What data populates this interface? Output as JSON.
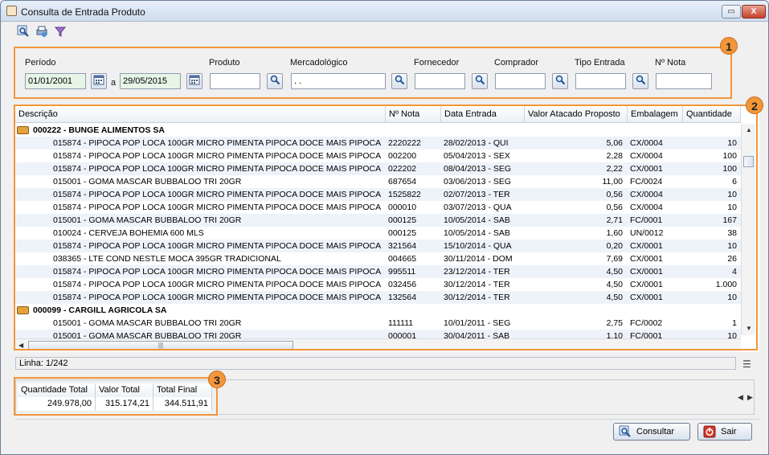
{
  "window": {
    "title": "Consulta de Entrada Produto",
    "restore_glyph": "▭",
    "close_glyph": "X"
  },
  "toolbar": {
    "icons": [
      "search-icon",
      "print-icon",
      "filter-icon"
    ]
  },
  "filters": {
    "periodo_label": "Período",
    "periodo_from": "01/01/2001",
    "periodo_sep": "a",
    "periodo_to": "29/05/2015",
    "produto_label": "Produto",
    "produto_value": "",
    "mercadologico_label": "Mercadológico",
    "mercadologico_value": " .  .",
    "fornecedor_label": "Fornecedor",
    "fornecedor_value": "",
    "comprador_label": "Comprador",
    "comprador_value": "",
    "tipo_entrada_label": "Tipo Entrada",
    "tipo_entrada_value": "",
    "nota_label": "Nº Nota",
    "nota_value": ""
  },
  "annotations": {
    "badge1": "1",
    "badge2": "2",
    "badge3": "3"
  },
  "grid": {
    "columns": [
      "Descrição",
      "Nº Nota",
      "Data Entrada",
      "Valor Atacado Proposto",
      "Embalagem",
      "Quantidade"
    ],
    "rows": [
      {
        "group": true,
        "text": "000222 - BUNGE ALIMENTOS SA"
      },
      {
        "desc": "015874 - PIPOCA POP LOCA 100GR MICRO PIMENTA PIPOCA DOCE MAIS PIPOCA",
        "nota": "2220222",
        "data": "28/02/2013 - QUI",
        "valor": "5,06",
        "emb": "CX/0004",
        "qtd": "10"
      },
      {
        "desc": "015874 - PIPOCA POP LOCA 100GR MICRO PIMENTA PIPOCA DOCE MAIS PIPOCA",
        "nota": "002200",
        "data": "05/04/2013 - SEX",
        "valor": "2,28",
        "emb": "CX/0004",
        "qtd": "100"
      },
      {
        "desc": "015874 - PIPOCA POP LOCA 100GR MICRO PIMENTA PIPOCA DOCE MAIS PIPOCA",
        "nota": "022202",
        "data": "08/04/2013 - SEG",
        "valor": "2,22",
        "emb": "CX/0001",
        "qtd": "100"
      },
      {
        "desc": "015001 - GOMA MASCAR BUBBALOO TRI 20GR",
        "nota": "687654",
        "data": "03/06/2013 - SEG",
        "valor": "11,00",
        "emb": "FC/0024",
        "qtd": "6"
      },
      {
        "desc": "015874 - PIPOCA POP LOCA 100GR MICRO PIMENTA PIPOCA DOCE MAIS PIPOCA",
        "nota": "1525822",
        "data": "02/07/2013 - TER",
        "valor": "0,56",
        "emb": "CX/0004",
        "qtd": "10"
      },
      {
        "desc": "015874 - PIPOCA POP LOCA 100GR MICRO PIMENTA PIPOCA DOCE MAIS PIPOCA",
        "nota": "000010",
        "data": "03/07/2013 - QUA",
        "valor": "0,56",
        "emb": "CX/0004",
        "qtd": "10"
      },
      {
        "desc": "015001 - GOMA MASCAR BUBBALOO TRI 20GR",
        "nota": "000125",
        "data": "10/05/2014 - SAB",
        "valor": "2,71",
        "emb": "FC/0001",
        "qtd": "167"
      },
      {
        "desc": "010024 - CERVEJA BOHEMIA 600 MLS",
        "nota": "000125",
        "data": "10/05/2014 - SAB",
        "valor": "1,60",
        "emb": "UN/0012",
        "qtd": "38"
      },
      {
        "desc": "015874 - PIPOCA POP LOCA 100GR MICRO PIMENTA PIPOCA DOCE MAIS PIPOCA",
        "nota": "321564",
        "data": "15/10/2014 - QUA",
        "valor": "0,20",
        "emb": "CX/0001",
        "qtd": "10"
      },
      {
        "desc": "038365 - LTE COND NESTLE MOCA 395GR TRADICIONAL",
        "nota": "004665",
        "data": "30/11/2014 - DOM",
        "valor": "7,69",
        "emb": "CX/0001",
        "qtd": "26"
      },
      {
        "desc": "015874 - PIPOCA POP LOCA 100GR MICRO PIMENTA PIPOCA DOCE MAIS PIPOCA",
        "nota": "995511",
        "data": "23/12/2014 - TER",
        "valor": "4,50",
        "emb": "CX/0001",
        "qtd": "4"
      },
      {
        "desc": "015874 - PIPOCA POP LOCA 100GR MICRO PIMENTA PIPOCA DOCE MAIS PIPOCA",
        "nota": "032456",
        "data": "30/12/2014 - TER",
        "valor": "4,50",
        "emb": "CX/0001",
        "qtd": "1.000"
      },
      {
        "desc": "015874 - PIPOCA POP LOCA 100GR MICRO PIMENTA PIPOCA DOCE MAIS PIPOCA",
        "nota": "132564",
        "data": "30/12/2014 - TER",
        "valor": "4,50",
        "emb": "CX/0001",
        "qtd": "10"
      },
      {
        "group": true,
        "text": "000099 - CARGILL AGRICOLA SA"
      },
      {
        "desc": "015001 - GOMA MASCAR BUBBALOO TRI 20GR",
        "nota": "111111",
        "data": "10/01/2011 - SEG",
        "valor": "2,75",
        "emb": "FC/0002",
        "qtd": "1"
      },
      {
        "desc": "015001 - GOMA MASCAR BUBBALOO TRI 20GR",
        "nota": "000001",
        "data": "30/04/2011 - SAB",
        "valor": "1,10",
        "emb": "FC/0001",
        "qtd": "10"
      }
    ]
  },
  "status": {
    "linha": "Linha: 1/242"
  },
  "totals": {
    "headers": [
      "Quantidade Total",
      "Valor Total",
      "Total Final"
    ],
    "values": [
      "249.978,00",
      "315.174,21",
      "344.511,91"
    ]
  },
  "buttons": {
    "consultar": "Consultar",
    "sair": "Sair"
  }
}
